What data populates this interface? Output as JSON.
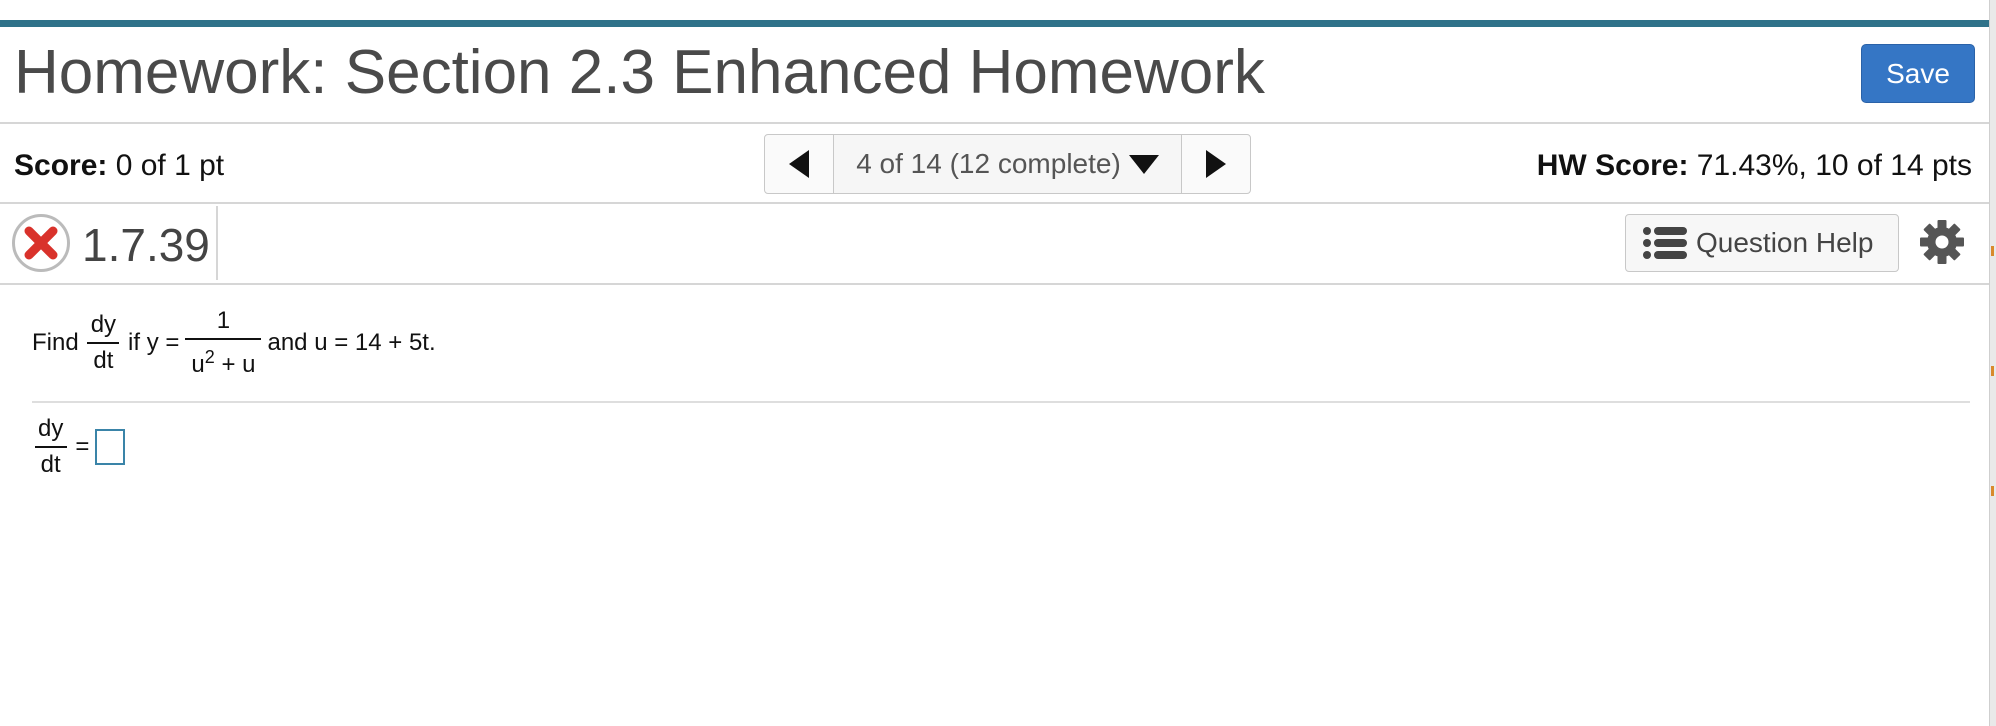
{
  "header": {
    "title": "Homework: Section 2.3 Enhanced Homework",
    "save_label": "Save"
  },
  "status": {
    "score_label": "Score:",
    "score_value": "0 of 1 pt",
    "hw_score_label": "HW Score:",
    "hw_score_value": "71.43%, 10 of 14 pts"
  },
  "pager": {
    "label": "4 of 14 (12 complete)"
  },
  "question": {
    "number": "1.7.39",
    "status": "incorrect",
    "help_label": "Question Help",
    "prompt": {
      "find": "Find",
      "deriv_num": "dy",
      "deriv_den": "dt",
      "if_y": "if y =",
      "frac_num": "1",
      "frac_den_base": "u",
      "frac_den_exp": "2",
      "frac_den_rest": "+ u",
      "and_u": "and u = 14 + 5t."
    },
    "answer": {
      "deriv_num": "dy",
      "deriv_den": "dt",
      "equals": "=",
      "value": ""
    }
  },
  "colors": {
    "top_bar": "#2f7289",
    "save_button": "#3576c5",
    "incorrect_x": "#d9322b",
    "answer_border": "#3a84a8"
  },
  "icons": [
    "incorrect-x-icon",
    "triangle-left-icon",
    "triangle-right-icon",
    "caret-down-icon",
    "list-icon",
    "gear-icon"
  ]
}
